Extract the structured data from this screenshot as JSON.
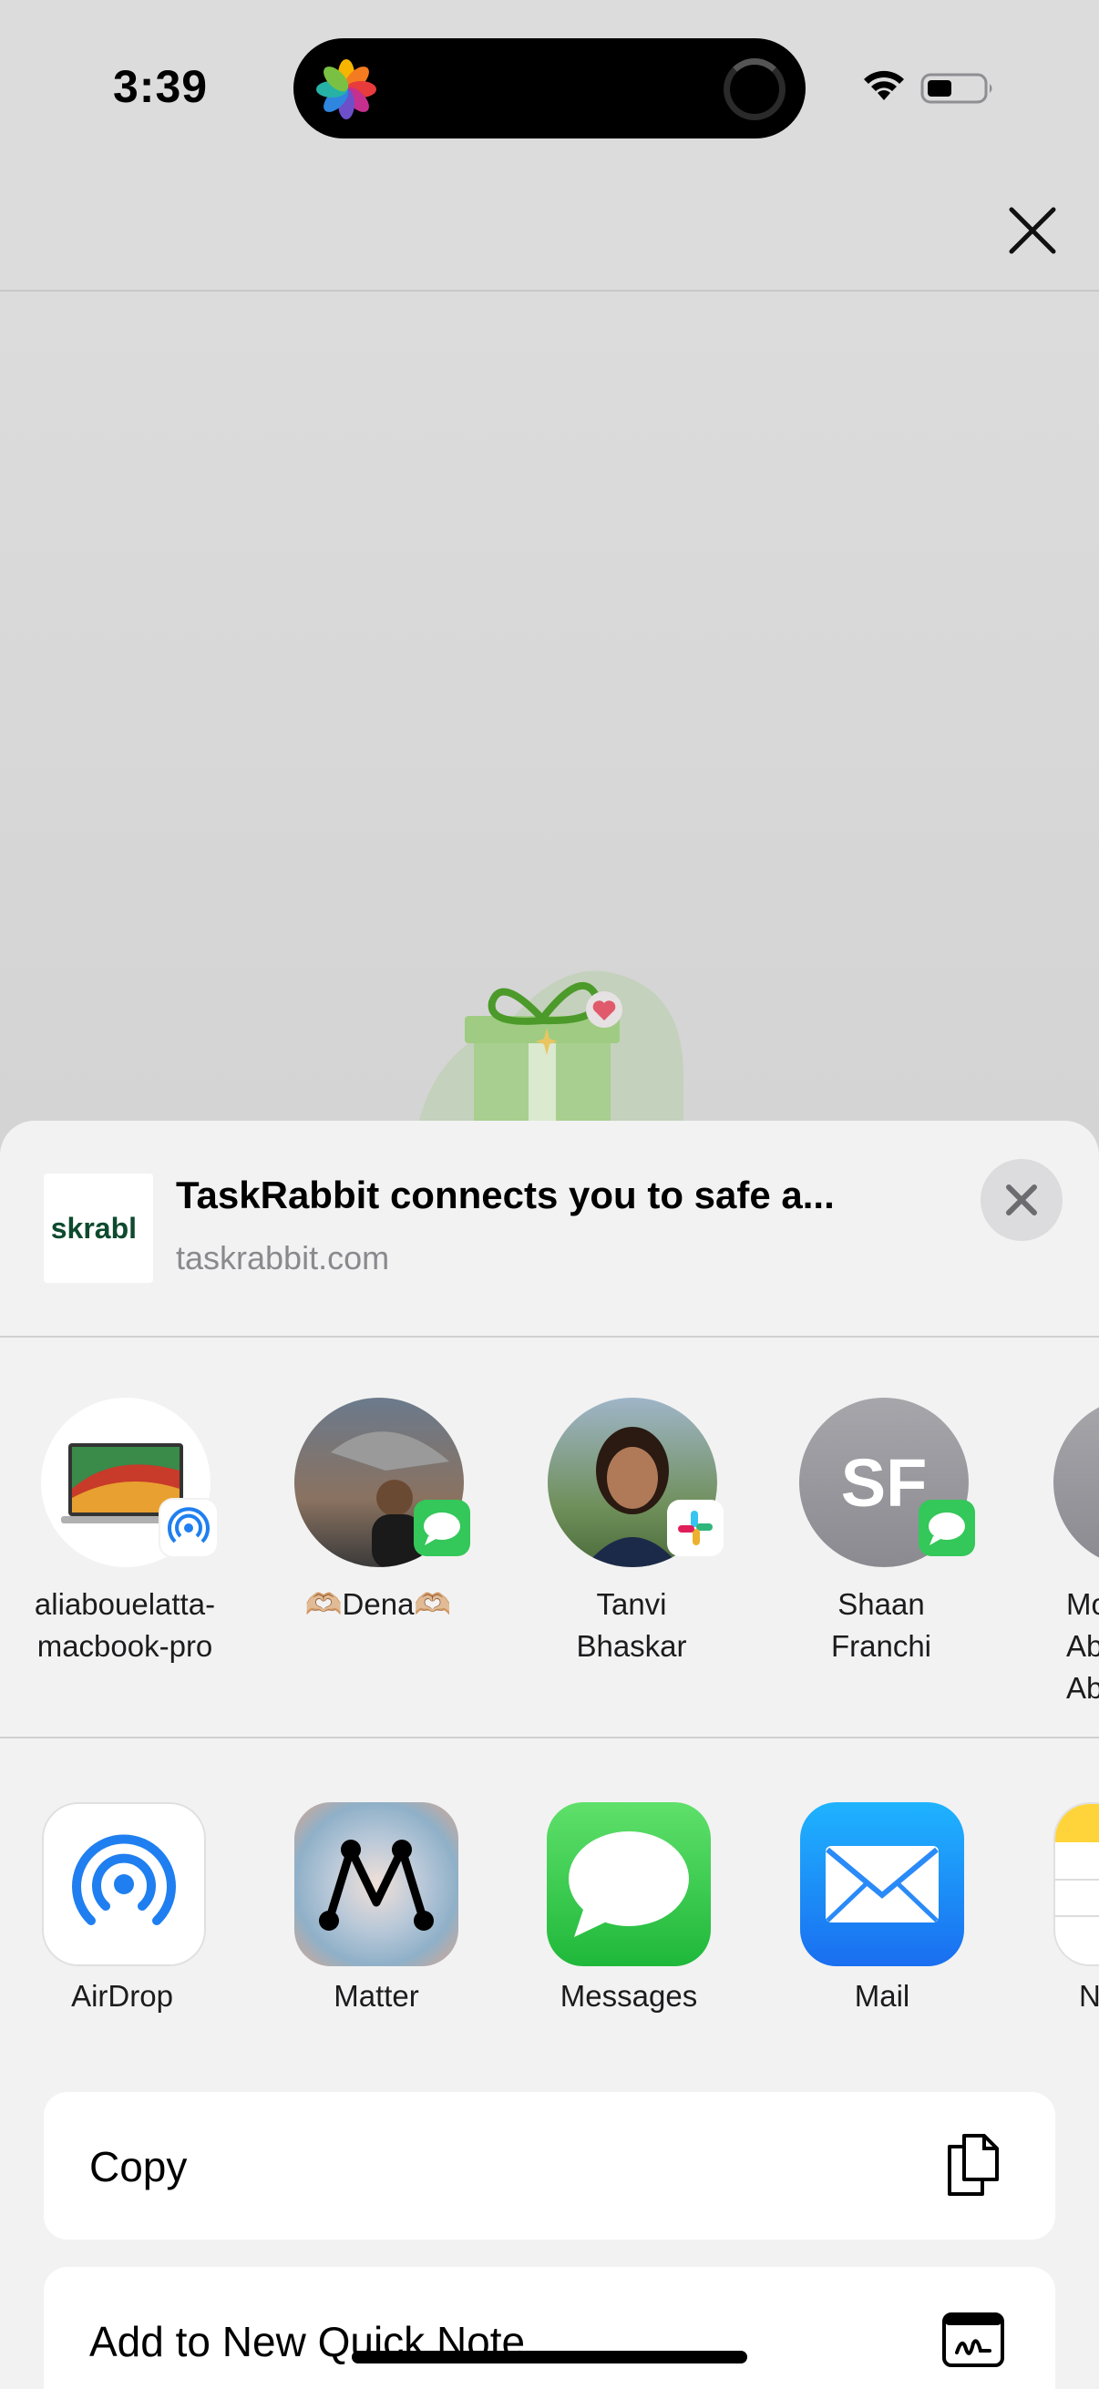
{
  "status_bar": {
    "time": "3:39"
  },
  "sheet": {
    "thumbnail_text": "skrabl",
    "title": "TaskRabbit connects you to safe a...",
    "domain": "taskrabbit.com"
  },
  "people": [
    {
      "name_line1": "aliabouelatta-",
      "name_line2": "macbook-pro",
      "badge": "airdrop-badge"
    },
    {
      "name_line1": "🫶🏼Dena🫶🏼",
      "name_line2": "",
      "badge": "messages-badge"
    },
    {
      "name_line1": "Tanvi",
      "name_line2": "Bhaskar",
      "badge": "slack-badge"
    },
    {
      "name_line1": "Shaan",
      "name_line2": "Franchi",
      "initials": "SF",
      "badge": "messages-badge"
    },
    {
      "name_line1": "Mo",
      "name_line2": "Ab",
      "name_line3": "Ab"
    }
  ],
  "apps": [
    {
      "label": "AirDrop"
    },
    {
      "label": "Matter"
    },
    {
      "label": "Messages"
    },
    {
      "label": "Mail"
    },
    {
      "label": "N"
    }
  ],
  "actions": [
    {
      "label": "Copy"
    },
    {
      "label": "Add to New Quick Note"
    }
  ],
  "colors": {
    "sheet_bg": "#f2f2f2",
    "messages_green": "#34c759",
    "mail_blue": "#1a82fb",
    "airdrop_blue": "#1f7ff0"
  }
}
